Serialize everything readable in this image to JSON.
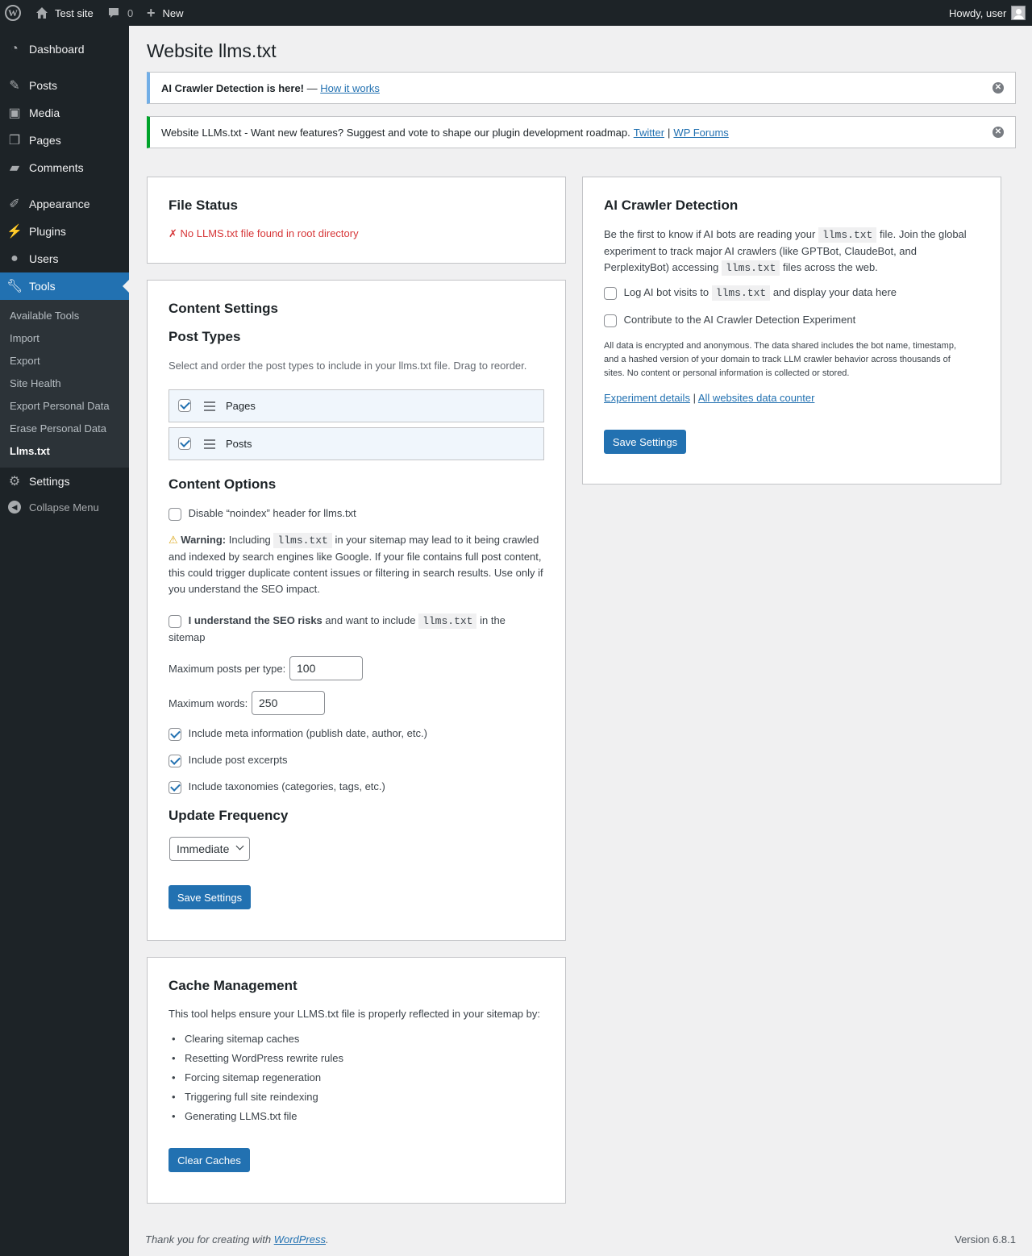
{
  "adminbar": {
    "site_name": "Test site",
    "comments_count": "0",
    "new_label": "New",
    "howdy": "Howdy, user"
  },
  "sidebar": {
    "items": [
      {
        "label": "Dashboard",
        "icon": "dashboard-icon"
      },
      {
        "label": "Posts",
        "icon": "pin-icon"
      },
      {
        "label": "Media",
        "icon": "media-icon"
      },
      {
        "label": "Pages",
        "icon": "pages-icon"
      },
      {
        "label": "Comments",
        "icon": "comment-icon"
      },
      {
        "label": "Appearance",
        "icon": "brush-icon"
      },
      {
        "label": "Plugins",
        "icon": "plugin-icon"
      },
      {
        "label": "Users",
        "icon": "user-icon"
      },
      {
        "label": "Tools",
        "icon": "wrench-icon"
      },
      {
        "label": "Settings",
        "icon": "settings-icon"
      }
    ],
    "submenu": [
      "Available Tools",
      "Import",
      "Export",
      "Site Health",
      "Export Personal Data",
      "Erase Personal Data",
      "Llms.txt"
    ],
    "collapse": "Collapse Menu"
  },
  "page": {
    "title": "Website llms.txt"
  },
  "notices": {
    "info_bold": "AI Crawler Detection is here!",
    "info_sep": " — ",
    "info_link": "How it works",
    "success_text": "Website LLMs.txt - Want new features? Suggest and vote to shape our plugin development roadmap.",
    "twitter": "Twitter",
    "pipe": "|",
    "forums": "WP Forums"
  },
  "file_status": {
    "title": "File Status",
    "message": "✗ No LLMS.txt file found in root directory"
  },
  "content_settings": {
    "title": "Content Settings",
    "post_types_title": "Post Types",
    "post_types_desc": "Select and order the post types to include in your llms.txt file. Drag to reorder.",
    "post_types": [
      {
        "label": "Pages",
        "checked": true
      },
      {
        "label": "Posts",
        "checked": true
      }
    ],
    "content_options_title": "Content Options",
    "noindex_label": "Disable “noindex” header for llms.txt",
    "warning_bold": "Warning:",
    "warning_pre": "Including",
    "warning_code": "llms.txt",
    "warning_l1_post": "in your sitemap may lead to it being crawled",
    "warning_l2": "and indexed by search engines like Google. If your file contains full post content,",
    "warning_l3": "this could trigger duplicate content issues or filtering in search results. Use only if",
    "warning_l4": "you understand the SEO impact.",
    "seo_bold": "I understand the SEO risks",
    "seo_mid": "and want to include",
    "seo_code": "llms.txt",
    "seo_post": "in the",
    "seo_l2": "sitemap",
    "max_posts_label": "Maximum posts per type:",
    "max_posts_value": "100",
    "max_words_label": "Maximum words:",
    "max_words_value": "250",
    "meta_label": "Include meta information (publish date, author, etc.)",
    "excerpts_label": "Include post excerpts",
    "taxonomies_label": "Include taxonomies (categories, tags, etc.)",
    "update_title": "Update Frequency",
    "frequency_value": "Immediate",
    "save_label": "Save Settings"
  },
  "cache": {
    "title": "Cache Management",
    "desc": "This tool helps ensure your LLMS.txt file is properly reflected in your sitemap by:",
    "items": [
      "Clearing sitemap caches",
      "Resetting WordPress rewrite rules",
      "Forcing sitemap regeneration",
      "Triggering full site reindexing",
      "Generating LLMS.txt file"
    ],
    "button": "Clear Caches"
  },
  "crawler": {
    "title": "AI Crawler Detection",
    "l1_pre": "Be the first to know if AI bots are reading your",
    "l1_code": "llms.txt",
    "l1_post": "file. Join the global",
    "l2": "experiment to track major AI crawlers (like GPTBot, ClaudeBot, and",
    "l3_pre": "PerplexityBot) accessing",
    "l3_code": "llms.txt",
    "l3_post": "files across the web.",
    "log_pre": "Log AI bot visits to",
    "log_code": "llms.txt",
    "log_post": "and display your data here",
    "contribute": "Contribute to the AI Crawler Detection Experiment",
    "privacy_l1": "All data is encrypted and anonymous. The data shared includes the bot name, timestamp,",
    "privacy_l2": "and a hashed version of your domain to track LLM crawler behavior across thousands of",
    "privacy_l3": "sites. No content or personal information is collected or stored.",
    "link_details": "Experiment details",
    "link_sep": "|",
    "link_counter": "All websites data counter",
    "save_label": "Save Settings"
  },
  "footer": {
    "thanks": "Thank you for creating with",
    "wp": "WordPress",
    "dot": ".",
    "version": "Version 6.8.1"
  },
  "colors": {
    "accent": "#2271b1",
    "adminbar_bg": "#1d2327",
    "error": "#d63638",
    "success_border": "#00a32a",
    "info_border": "#72aee6"
  }
}
